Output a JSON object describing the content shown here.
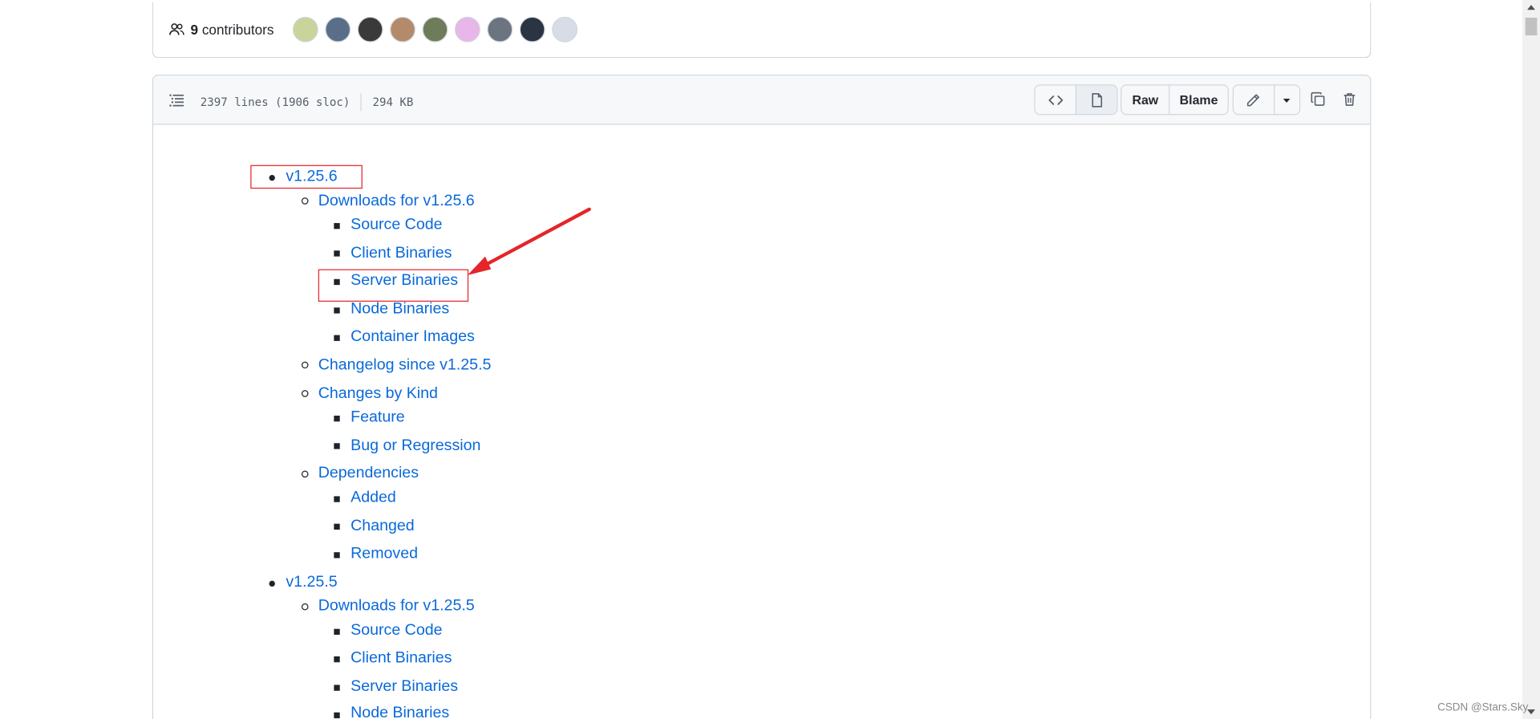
{
  "contributors": {
    "count_label": "9",
    "suffix": "contributors",
    "avatars": [
      {
        "name": "avatar-1",
        "color": "#c8d49a"
      },
      {
        "name": "avatar-2",
        "color": "#5a6e8a"
      },
      {
        "name": "avatar-3",
        "color": "#3a3a3a"
      },
      {
        "name": "avatar-4",
        "color": "#b38a6a"
      },
      {
        "name": "avatar-5",
        "color": "#6f7c5a"
      },
      {
        "name": "avatar-6",
        "color": "#e8b6e8"
      },
      {
        "name": "avatar-7",
        "color": "#6c7480"
      },
      {
        "name": "avatar-8",
        "color": "#2a3442"
      },
      {
        "name": "avatar-9",
        "color": "#d8dce6"
      }
    ]
  },
  "file_header": {
    "lines": "2397 lines (1906 sloc)",
    "size": "294 KB",
    "raw_label": "Raw",
    "blame_label": "Blame"
  },
  "toc": {
    "v1_25_6": {
      "label": "v1.25.6",
      "downloads": "Downloads for v1.25.6",
      "source": "Source Code",
      "client": "Client Binaries",
      "server": "Server Binaries",
      "node": "Node Binaries",
      "container": "Container Images",
      "changelog": "Changelog since v1.25.5",
      "changes_by_kind": "Changes by Kind",
      "feature": "Feature",
      "bug": "Bug or Regression",
      "dependencies": "Dependencies",
      "added": "Added",
      "changed": "Changed",
      "removed": "Removed"
    },
    "v1_25_5": {
      "label": "v1.25.5",
      "downloads": "Downloads for v1.25.5",
      "source": "Source Code",
      "client": "Client Binaries",
      "server": "Server Binaries",
      "node": "Node Binaries"
    }
  },
  "watermark": "CSDN @Stars.Sky",
  "colors": {
    "link": "#0969da",
    "highlight": "#e5252a",
    "border": "#d0d7de"
  }
}
